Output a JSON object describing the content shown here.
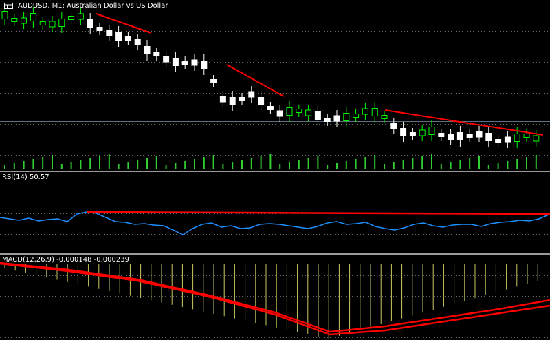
{
  "chart": {
    "title": "AUDUSD, M1:  Australian Dollar vs US Dollar",
    "icon": "chart-window-icon",
    "background": "#000000",
    "grid_color": "#c0c0c0",
    "bull_color": "#00ff00",
    "bear_body_color": "#ffffff",
    "hline_color": "#5a6e86",
    "volume_color": "#32cd32",
    "trendline_color": "#ff0000"
  },
  "rsi": {
    "label": "RSI(14) 50.57",
    "line_color": "#1e90ff"
  },
  "macd": {
    "label": "MACD(12,26,9) -0.000148 -0.000239",
    "hist_color": "#c8c864",
    "signal_color": "#ff0000"
  }
}
